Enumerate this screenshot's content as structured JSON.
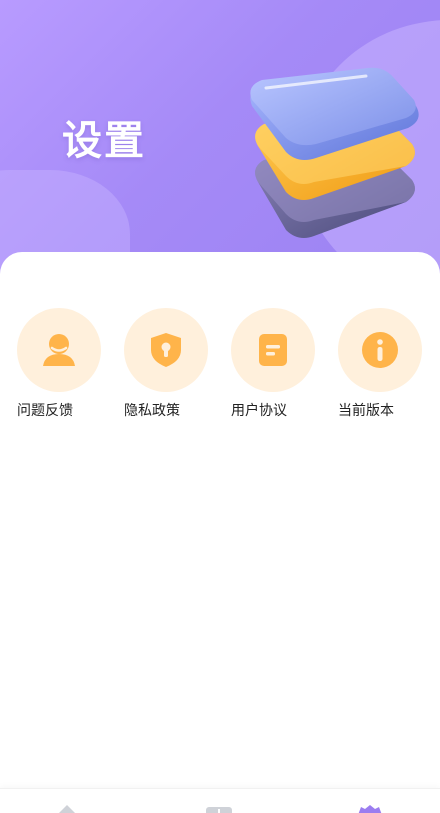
{
  "header": {
    "title": "设置"
  },
  "menu": {
    "items": [
      {
        "label": "问题反馈",
        "icon": "user-feedback-icon"
      },
      {
        "label": "隐私政策",
        "icon": "shield-lock-icon"
      },
      {
        "label": "用户协议",
        "icon": "document-icon"
      },
      {
        "label": "当前版本",
        "icon": "info-icon"
      }
    ]
  },
  "colors": {
    "header_gradient_start": "#b89bff",
    "header_gradient_end": "#9b82f2",
    "icon_circle_bg": "#fff0dc",
    "icon_orange": "#ffb44a",
    "label_text": "#222222"
  },
  "bottom_nav": {
    "items": [
      {
        "icon": "home-icon",
        "active": false
      },
      {
        "icon": "apps-icon",
        "active": false
      },
      {
        "icon": "settings-icon",
        "active": true
      }
    ]
  }
}
